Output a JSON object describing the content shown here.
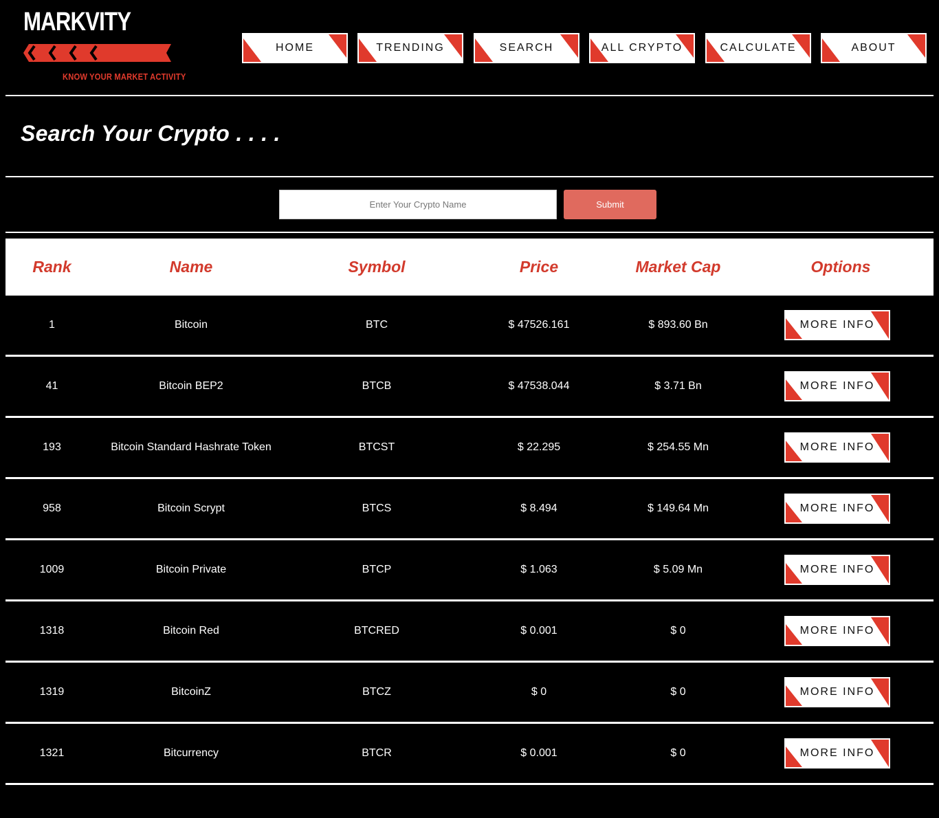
{
  "brand": {
    "name": "MARKVITY",
    "tagline": "KNOW YOUR MARKET ACTIVITY",
    "accent_color": "#e03a2c"
  },
  "nav": {
    "items": [
      {
        "label": "HOME"
      },
      {
        "label": "TRENDING"
      },
      {
        "label": "SEARCH"
      },
      {
        "label": "ALL CRYPTO"
      },
      {
        "label": "CALCULATE"
      },
      {
        "label": "ABOUT"
      }
    ]
  },
  "page": {
    "title": "Search Your Crypto . . . ."
  },
  "search": {
    "placeholder": "Enter Your Crypto Name",
    "value": "",
    "submit_label": "Submit",
    "submit_color": "#e06a5e"
  },
  "table": {
    "headers": {
      "rank": "Rank",
      "name": "Name",
      "symbol": "Symbol",
      "price": "Price",
      "market_cap": "Market Cap",
      "options": "Options"
    },
    "header_color": "#d23a2c",
    "more_info_label": "MORE INFO",
    "rows": [
      {
        "rank": "1",
        "name": "Bitcoin",
        "symbol": "BTC",
        "price": "$ 47526.161",
        "market_cap": "$ 893.60 Bn"
      },
      {
        "rank": "41",
        "name": "Bitcoin BEP2",
        "symbol": "BTCB",
        "price": "$ 47538.044",
        "market_cap": "$ 3.71 Bn"
      },
      {
        "rank": "193",
        "name": "Bitcoin Standard Hashrate Token",
        "symbol": "BTCST",
        "price": "$ 22.295",
        "market_cap": "$ 254.55 Mn"
      },
      {
        "rank": "958",
        "name": "Bitcoin Scrypt",
        "symbol": "BTCS",
        "price": "$ 8.494",
        "market_cap": "$ 149.64 Mn"
      },
      {
        "rank": "1009",
        "name": "Bitcoin Private",
        "symbol": "BTCP",
        "price": "$ 1.063",
        "market_cap": "$ 5.09 Mn"
      },
      {
        "rank": "1318",
        "name": "Bitcoin Red",
        "symbol": "BTCRED",
        "price": "$ 0.001",
        "market_cap": "$ 0"
      },
      {
        "rank": "1319",
        "name": "BitcoinZ",
        "symbol": "BTCZ",
        "price": "$ 0",
        "market_cap": "$ 0"
      },
      {
        "rank": "1321",
        "name": "Bitcurrency",
        "symbol": "BTCR",
        "price": "$ 0.001",
        "market_cap": "$ 0"
      }
    ]
  }
}
